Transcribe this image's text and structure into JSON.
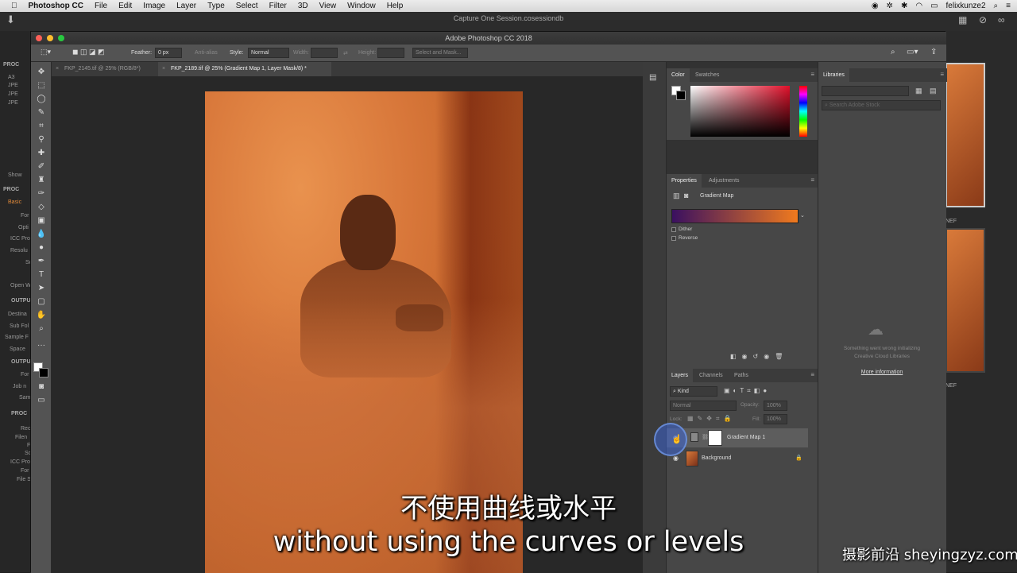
{
  "macbar": {
    "apple": "",
    "app": "Photoshop CC",
    "menus": [
      "File",
      "Edit",
      "Image",
      "Layer",
      "Type",
      "Select",
      "Filter",
      "3D",
      "View",
      "Window",
      "Help"
    ],
    "user": "felixkunze2"
  },
  "c1": {
    "session_title": "Capture One Session.cosessiondb",
    "left_labels": [
      "PROC",
      "A3",
      "JPE",
      "JPE",
      "JPE",
      "Show",
      "PROC",
      "Basic",
      "For",
      "Opti",
      "ICC Pro",
      "Resolu",
      "Sc",
      "Open W",
      "OUTPU",
      "Destina",
      "Sub Fol",
      "Sample F",
      "Space",
      "OUTPU",
      "For",
      "Job n",
      "Sam",
      "PROC",
      "Rec",
      "Filen",
      "F",
      "Sc",
      "ICC Pro",
      "For",
      "File S"
    ],
    "thumb_labels": [
      "NEF",
      "NEF"
    ]
  },
  "ps": {
    "window_title": "Adobe Photoshop CC 2018",
    "options": {
      "feather_label": "Feather:",
      "feather_value": "0 px",
      "antialias": "Anti-alias",
      "style_label": "Style:",
      "style_value": "Normal",
      "width_label": "Width:",
      "height_label": "Height:",
      "select_mask": "Select and Mask..."
    },
    "tabs": [
      {
        "label": "FKP_2145.tif @ 25% (RGB/8*)"
      },
      {
        "label": "FKP_2189.tif @ 25% (Gradient Map 1, Layer Mask/8) *"
      }
    ],
    "color_panel": {
      "tabs": [
        "Color",
        "Swatches"
      ]
    },
    "properties_panel": {
      "tabs": [
        "Properties",
        "Adjustments"
      ],
      "title": "Gradient Map",
      "dither": "Dither",
      "reverse": "Reverse"
    },
    "layers_panel": {
      "tabs": [
        "Layers",
        "Channels",
        "Paths"
      ],
      "kind": "Kind",
      "blend": "Normal",
      "opacity_label": "Opacity:",
      "opacity_value": "100%",
      "lock_label": "Lock:",
      "fill_label": "Fill:",
      "fill_value": "100%",
      "layers": [
        {
          "name": "Gradient Map 1"
        },
        {
          "name": "Background"
        }
      ]
    },
    "libraries_panel": {
      "tab": "Libraries",
      "search_placeholder": "Search Adobe Stock",
      "error_line1": "Something went wrong initializing",
      "error_line2": "Creative Cloud Libraries",
      "more_info": "More information"
    }
  },
  "subtitles": {
    "cn": "不使用曲线或水平",
    "en": "without using the curves or levels"
  },
  "watermark": "摄影前沿 sheyingzyz.com",
  "colors": {
    "gradient_start": "#3a1060",
    "gradient_end": "#f07a1e",
    "accent_orange": "#e08a3a",
    "highlight_blue": "#3c64d2"
  }
}
